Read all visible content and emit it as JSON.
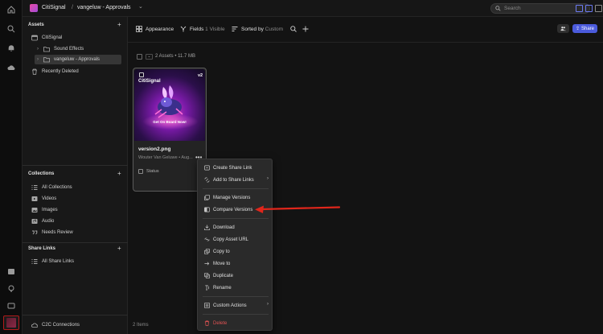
{
  "topbar": {
    "org": "CitiSignal",
    "separator": "/",
    "folder": "vangeluw - Approvals",
    "folder_chevron": "⌄",
    "search_placeholder": "Search"
  },
  "sidebar": {
    "assets_title": "Assets",
    "tree": [
      {
        "label": "CitiSignal",
        "icon": "brand-folder-icon"
      },
      {
        "label": "Sound Effects",
        "icon": "folder-icon"
      },
      {
        "label": "vangeluw - Approvals",
        "icon": "folder-icon",
        "active": true
      },
      {
        "label": "Recently Deleted",
        "icon": "trash-icon"
      }
    ],
    "collections_title": "Collections",
    "collections": [
      {
        "label": "All Collections",
        "icon": "list-icon"
      },
      {
        "label": "Videos",
        "icon": "video-icon"
      },
      {
        "label": "Images",
        "icon": "image-icon"
      },
      {
        "label": "Audio",
        "icon": "audio-icon"
      },
      {
        "label": "Needs Review",
        "icon": "quote-icon"
      }
    ],
    "share_links_title": "Share Links",
    "share_links": [
      {
        "label": "All Share Links",
        "icon": "list-icon"
      }
    ],
    "c2c": "C2C Connections"
  },
  "toolbar": {
    "appearance": "Appearance",
    "fields": "Fields",
    "fields_count": "1 Visible",
    "sorted": "Sorted by",
    "sorted_value": "Custom",
    "share": "Share"
  },
  "listing": {
    "count": "2 Assets • 11.7 MB",
    "footer": "2 Items"
  },
  "card": {
    "brand": "CitiSignal",
    "version_badge": "v2",
    "cta": "Get On Board Now!",
    "name": "version2.png",
    "meta": "Wouter Van Geluwe • Aug...",
    "more": "•••",
    "status": "Status"
  },
  "menu": {
    "items": [
      {
        "label": "Create Share Link",
        "icon": "link-icon"
      },
      {
        "label": "Add to Share Links",
        "icon": "add-link-icon",
        "submenu": "›"
      },
      {
        "label": "Manage Versions",
        "icon": "versions-icon"
      },
      {
        "label": "Compare Versions",
        "icon": "compare-icon"
      },
      {
        "label": "Download",
        "icon": "download-icon"
      },
      {
        "label": "Copy Asset URL",
        "icon": "copy-link-icon"
      },
      {
        "label": "Copy to",
        "icon": "copy-icon"
      },
      {
        "label": "Move to",
        "icon": "move-icon"
      },
      {
        "label": "Duplicate",
        "icon": "duplicate-icon"
      },
      {
        "label": "Rename",
        "icon": "rename-icon"
      },
      {
        "label": "Custom Actions",
        "icon": "actions-icon",
        "submenu": "›"
      },
      {
        "label": "Delete",
        "icon": "trash-icon",
        "danger": true
      }
    ]
  },
  "colors": {
    "accent": "#4b5bdc",
    "annotation_arrow": "#e0261b",
    "danger": "#e05353"
  }
}
